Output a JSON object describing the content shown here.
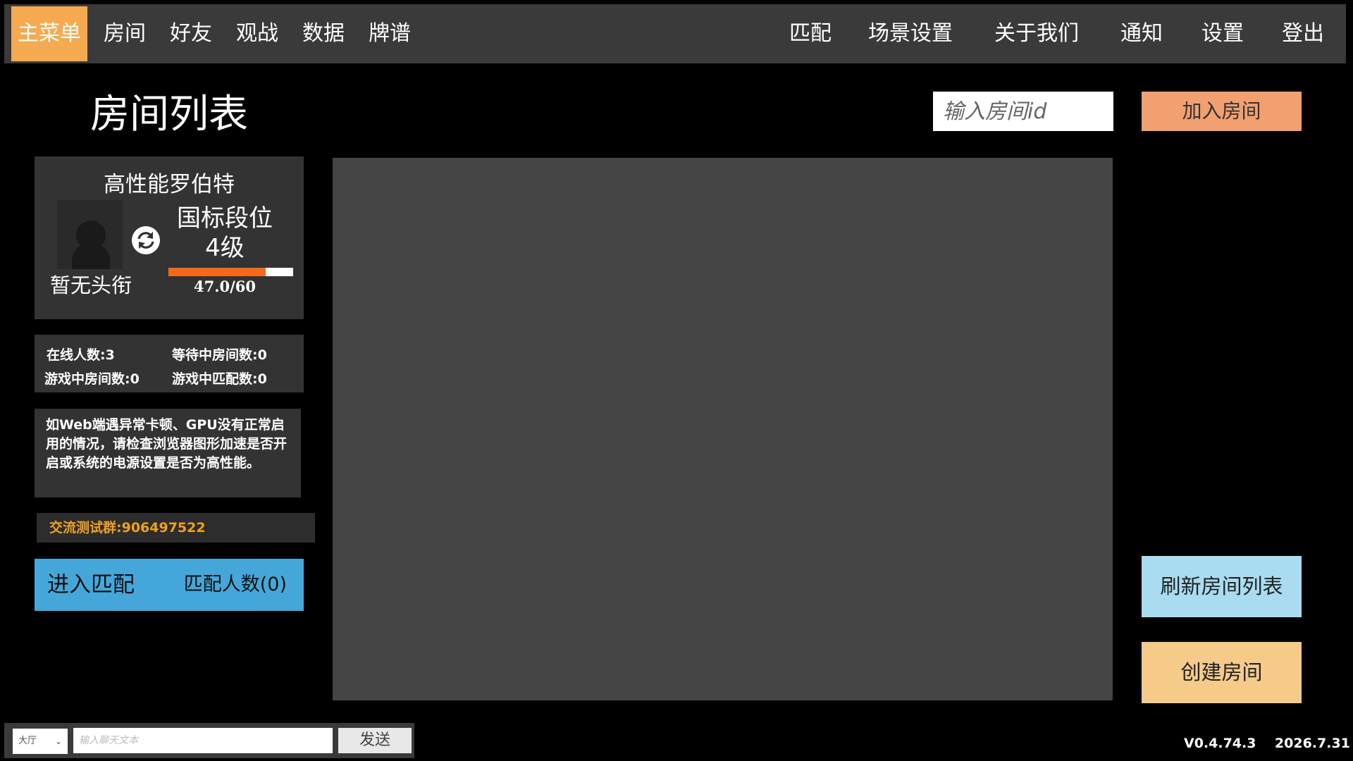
{
  "nav": {
    "left_items": [
      {
        "label": "主菜单",
        "active": true
      },
      {
        "label": "房间"
      },
      {
        "label": "好友"
      },
      {
        "label": "观战"
      },
      {
        "label": "数据"
      },
      {
        "label": "牌谱"
      }
    ],
    "right_items": [
      {
        "label": "匹配"
      },
      {
        "label": "场景设置"
      },
      {
        "label": "关于我们"
      },
      {
        "label": "通知"
      },
      {
        "label": "设置"
      },
      {
        "label": "登出"
      }
    ]
  },
  "page_title": "房间列表",
  "join": {
    "placeholder": "输入房间id",
    "button_label": "加入房间"
  },
  "profile": {
    "name": "高性能罗伯特",
    "title": "暂无头衔",
    "rank_name": "国标段位",
    "rank_level": "4级",
    "progress_text": "47.0/60",
    "progress_fraction": 0.78
  },
  "stats": {
    "online": "在线人数:3",
    "waiting_rooms": "等待中房间数:0",
    "playing_rooms": "游戏中房间数:0",
    "playing_matches": "游戏中匹配数:0"
  },
  "notice": "如Web端遇异常卡顿、GPU没有正常启用的情况，请检查浏览器图形加速是否开启或系统的电源设置是否为高性能。",
  "group": "交流测试群:906497522",
  "match": {
    "label": "进入匹配",
    "count": "匹配人数(0)"
  },
  "buttons": {
    "refresh": "刷新房间列表",
    "create": "创建房间"
  },
  "chat": {
    "channel": "大厅",
    "placeholder": "输入聊天文本",
    "send": "发送"
  },
  "version": "V0.4.74.3    2026.7.31",
  "colors": {
    "accent": "#f5aa4f",
    "nav_bg": "#3a3a3a",
    "match_blue": "#45a7d9",
    "join_orange": "#f2a070",
    "refresh_blue": "#a9dcf1",
    "create_yellow": "#f6cb8a",
    "group_text": "#f0a020",
    "progress_fill": "#f26a1b"
  },
  "icons": {
    "swap": "swap-icon",
    "avatar": "avatar-placeholder-icon",
    "dropdown": "chevron-down-icon"
  }
}
